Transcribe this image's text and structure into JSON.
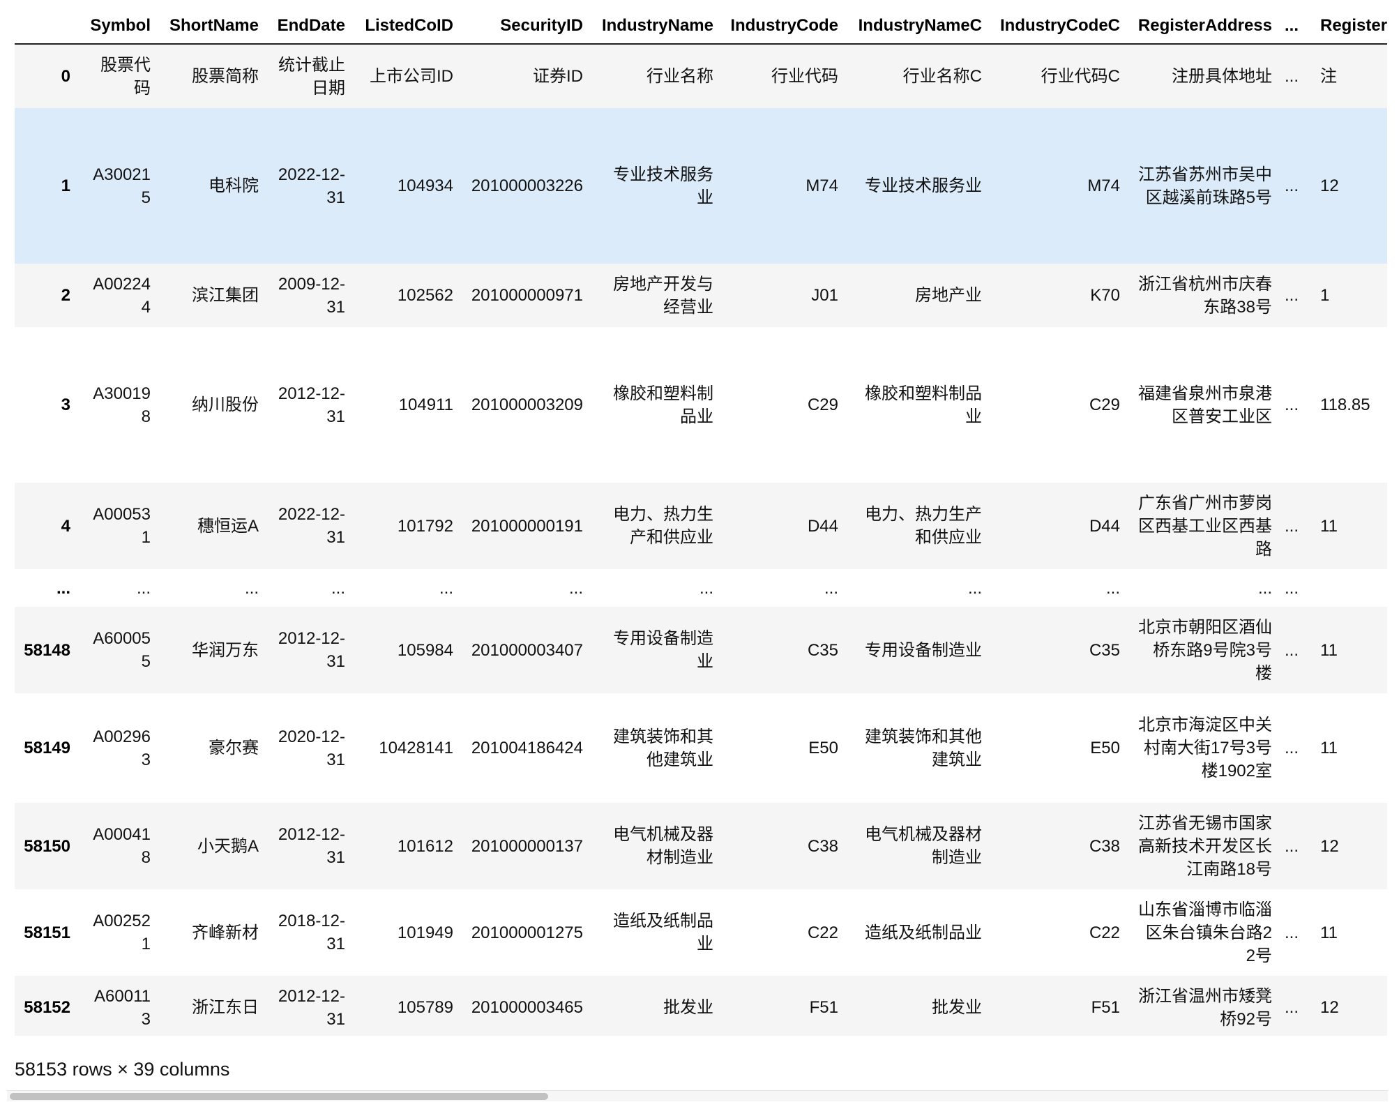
{
  "table": {
    "columns": [
      "",
      "Symbol",
      "ShortName",
      "EndDate",
      "ListedCoID",
      "SecurityID",
      "IndustryName",
      "IndustryCode",
      "IndustryNameC",
      "IndustryCodeC",
      "RegisterAddress",
      "...",
      "RegisterI"
    ],
    "rows": [
      {
        "index": "0",
        "cells": [
          "股票代码",
          "股票简称",
          "统计截止日期",
          "上市公司ID",
          "证券ID",
          "行业名称",
          "行业代码",
          "行业名称C",
          "行业代码C",
          "注册具体地址",
          "...",
          "注"
        ]
      },
      {
        "index": "1",
        "cells": [
          "A300215",
          "电科院",
          "2022-12-31",
          "104934",
          "201000003226",
          "专业技术服务业",
          "M74",
          "专业技术服务业",
          "M74",
          "江苏省苏州市吴中区越溪前珠路5号",
          "...",
          "12"
        ]
      },
      {
        "index": "2",
        "cells": [
          "A002244",
          "滨江集团",
          "2009-12-31",
          "102562",
          "201000000971",
          "房地产开发与经营业",
          "J01",
          "房地产业",
          "K70",
          "浙江省杭州市庆春东路38号",
          "...",
          "1"
        ]
      },
      {
        "index": "3",
        "cells": [
          "A300198",
          "纳川股份",
          "2012-12-31",
          "104911",
          "201000003209",
          "橡胶和塑料制品业",
          "C29",
          "橡胶和塑料制品业",
          "C29",
          "福建省泉州市泉港区普安工业区",
          "...",
          "118.85"
        ]
      },
      {
        "index": "4",
        "cells": [
          "A000531",
          "穗恒运A",
          "2022-12-31",
          "101792",
          "201000000191",
          "电力、热力生产和供应业",
          "D44",
          "电力、热力生产和供应业",
          "D44",
          "广东省广州市萝岗区西基工业区西基路",
          "...",
          "11"
        ]
      },
      {
        "index": "...",
        "cells": [
          "...",
          "...",
          "...",
          "...",
          "...",
          "...",
          "...",
          "...",
          "...",
          "...",
          "...",
          ""
        ]
      },
      {
        "index": "58148",
        "cells": [
          "A600055",
          "华润万东",
          "2012-12-31",
          "105984",
          "201000003407",
          "专用设备制造业",
          "C35",
          "专用设备制造业",
          "C35",
          "北京市朝阳区酒仙桥东路9号院3号楼",
          "...",
          "11"
        ]
      },
      {
        "index": "58149",
        "cells": [
          "A002963",
          "豪尔赛",
          "2020-12-31",
          "10428141",
          "201004186424",
          "建筑装饰和其他建筑业",
          "E50",
          "建筑装饰和其他建筑业",
          "E50",
          "北京市海淀区中关村南大街17号3号楼1902室",
          "...",
          "11"
        ]
      },
      {
        "index": "58150",
        "cells": [
          "A000418",
          "小天鹅A",
          "2012-12-31",
          "101612",
          "201000000137",
          "电气机械及器材制造业",
          "C38",
          "电气机械及器材制造业",
          "C38",
          "江苏省无锡市国家高新技术开发区长江南路18号",
          "...",
          "12"
        ]
      },
      {
        "index": "58151",
        "cells": [
          "A002521",
          "齐峰新材",
          "2018-12-31",
          "101949",
          "201000001275",
          "造纸及纸制品业",
          "C22",
          "造纸及纸制品业",
          "C22",
          "山东省淄博市临淄区朱台镇朱台路22号",
          "...",
          "11"
        ]
      },
      {
        "index": "58152",
        "cells": [
          "A600113",
          "浙江东日",
          "2012-12-31",
          "105789",
          "201000003465",
          "批发业",
          "F51",
          "批发业",
          "F51",
          "浙江省温州市矮凳桥92号",
          "...",
          "12"
        ]
      }
    ]
  },
  "shape_text": "58153 rows × 39 columns",
  "scrollbar": {
    "thumb_fraction": 0.39
  },
  "colors": {
    "row_odd": "#f5f5f5",
    "row_even": "#ffffff",
    "row_hover": "#dcebfa",
    "header_rule": "#222222",
    "scroll_thumb": "#c1c1c1"
  }
}
